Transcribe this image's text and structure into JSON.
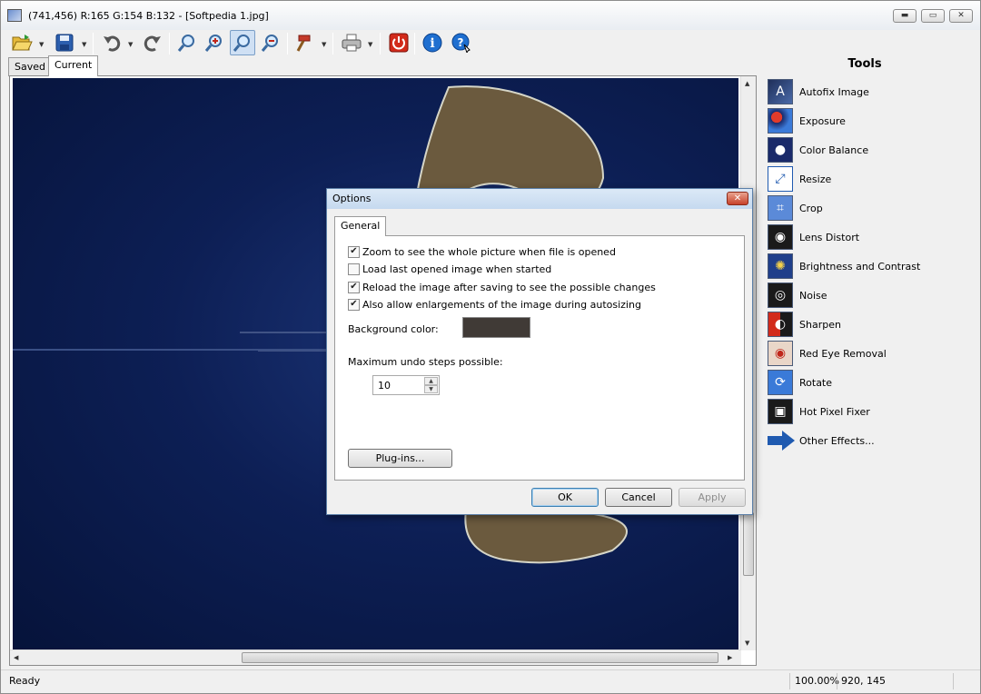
{
  "window": {
    "title": "(741,456)  R:165  G:154  B:132 - [Softpedia 1.jpg]",
    "controls": {
      "minimize": "▬",
      "maximize": "▭",
      "close": "✕"
    }
  },
  "toolbar": {
    "items": [
      {
        "name": "open-icon"
      },
      {
        "name": "save-icon"
      },
      {
        "name": "undo-icon"
      },
      {
        "name": "redo-icon"
      },
      {
        "name": "zoom-fit-icon"
      },
      {
        "name": "zoom-in-icon"
      },
      {
        "name": "zoom-actual-icon"
      },
      {
        "name": "zoom-out-icon"
      },
      {
        "name": "hammer-icon"
      },
      {
        "name": "print-icon"
      },
      {
        "name": "power-icon"
      },
      {
        "name": "info-icon"
      },
      {
        "name": "help-icon"
      }
    ]
  },
  "tabs": {
    "saved": "Saved",
    "current": "Current"
  },
  "tools": {
    "title": "Tools",
    "items": [
      {
        "label": "Autofix Image",
        "icon": "autofix-icon"
      },
      {
        "label": "Exposure",
        "icon": "exposure-icon"
      },
      {
        "label": "Color Balance",
        "icon": "color-balance-icon"
      },
      {
        "label": "Resize",
        "icon": "resize-icon"
      },
      {
        "label": "Crop",
        "icon": "crop-icon"
      },
      {
        "label": "Lens Distort",
        "icon": "lens-distort-icon"
      },
      {
        "label": "Brightness and Contrast",
        "icon": "brightness-icon"
      },
      {
        "label": "Noise",
        "icon": "noise-icon"
      },
      {
        "label": "Sharpen",
        "icon": "sharpen-icon"
      },
      {
        "label": "Red Eye Removal",
        "icon": "red-eye-icon"
      },
      {
        "label": "Rotate",
        "icon": "rotate-icon"
      },
      {
        "label": "Hot Pixel Fixer",
        "icon": "hot-pixel-icon"
      },
      {
        "label": "Other Effects...",
        "icon": "arrow-right-icon"
      }
    ]
  },
  "status": {
    "text": "Ready",
    "zoom": "100.00%",
    "coords": "920, 145"
  },
  "dialog": {
    "title": "Options",
    "tab": "General",
    "checkboxes": [
      {
        "label": "Zoom to see the whole picture when file is opened",
        "checked": true
      },
      {
        "label": "Load last opened image when started",
        "checked": false
      },
      {
        "label": "Reload the image after saving to see the possible changes",
        "checked": true
      },
      {
        "label": "Also allow enlargements of the image during autosizing",
        "checked": true
      }
    ],
    "background_label": "Background color:",
    "background_color": "#403a36",
    "undo_label": "Maximum undo steps possible:",
    "undo_value": "10",
    "plugins_button": "Plug-ins...",
    "ok_button": "OK",
    "cancel_button": "Cancel",
    "apply_button": "Apply"
  }
}
